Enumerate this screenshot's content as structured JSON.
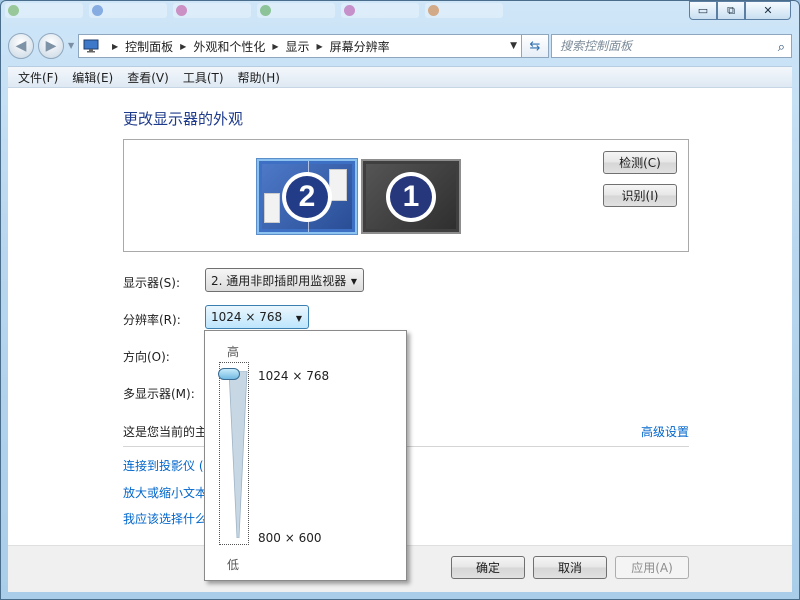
{
  "window": {
    "caption_minimize": "▭",
    "caption_maximize": "⧉",
    "caption_close": "✕"
  },
  "nav": {
    "breadcrumbs": [
      "控制面板",
      "外观和个性化",
      "显示",
      "屏幕分辨率"
    ],
    "search_placeholder": "搜索控制面板"
  },
  "menu": {
    "items": [
      "文件(F)",
      "编辑(E)",
      "查看(V)",
      "工具(T)",
      "帮助(H)"
    ]
  },
  "main": {
    "heading": "更改显示器的外观",
    "monitor_2_number": "2",
    "monitor_1_number": "1",
    "detect_button": "检测(C)",
    "identify_button": "识别(I)",
    "display_label": "显示器(S):",
    "display_value": "2. 通用非即插即用监视器",
    "resolution_label": "分辨率(R):",
    "resolution_value": "1024 × 768",
    "orientation_label": "方向(O):",
    "multi_display_label": "多显示器(M):",
    "primary_text": "这是您当前的主",
    "advanced_link": "高级设置",
    "link_projector": "连接到投影仪 (",
    "link_text_size": "放大或缩小文本",
    "link_which": "我应该选择什么"
  },
  "popup": {
    "high_label": "高",
    "low_label": "低",
    "option_high": "1024 × 768",
    "option_low": "800 × 600",
    "slider_position_fraction": 0.0
  },
  "footer": {
    "ok_button": "确定",
    "cancel_button": "取消",
    "apply_button": "应用(A)"
  },
  "colors": {
    "link": "#0066cc",
    "heading": "#1e3a8a",
    "selected_monitor": "#3d6fc4"
  }
}
